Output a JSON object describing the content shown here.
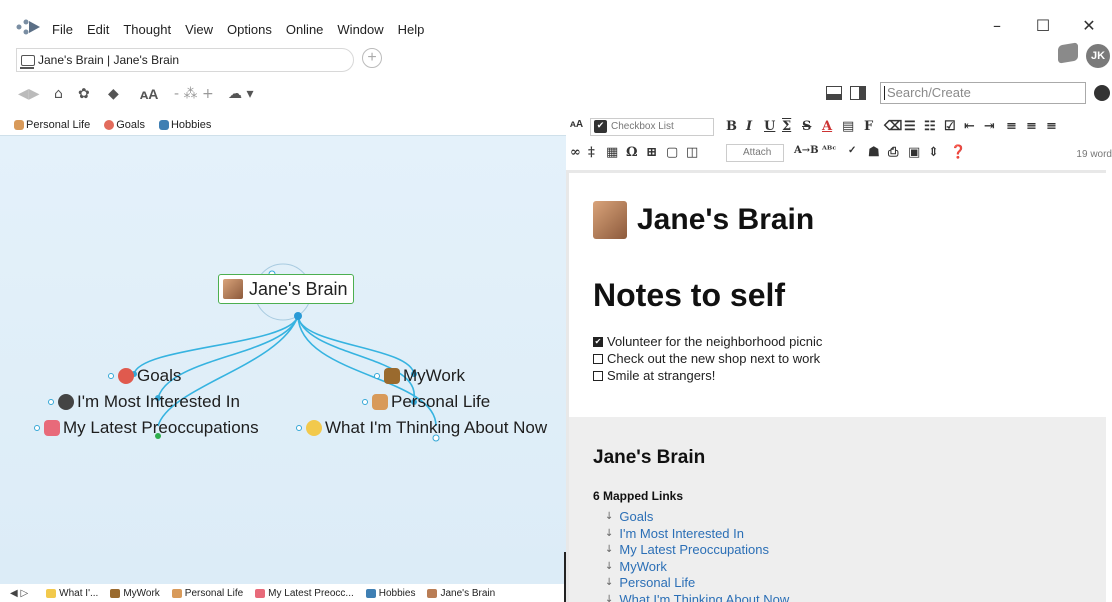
{
  "menu": {
    "items": [
      "File",
      "Edit",
      "Thought",
      "View",
      "Options",
      "Online",
      "Window",
      "Help"
    ]
  },
  "window_controls": {
    "minimize": "–",
    "maximize": "☐",
    "close": "✕"
  },
  "tab": {
    "title": "Jane's Brain | Jane's Brain",
    "new_tab_symbol": "+"
  },
  "account": {
    "initials": "JK"
  },
  "toolbar": {
    "search_placeholder": "Search/Create",
    "icons": [
      "back-forward-icon",
      "home-icon",
      "brain-icon",
      "tag-icon",
      "font-size-icon",
      "layout-icon",
      "cloud-icon"
    ]
  },
  "pins": [
    {
      "label": "Personal Life",
      "color": "#d89a5a"
    },
    {
      "label": "Goals",
      "color": "#e26b5c"
    },
    {
      "label": "Hobbies",
      "color": "#3f7fb3"
    }
  ],
  "plex": {
    "central": "Jane's Brain",
    "children_left": [
      {
        "label": "Goals",
        "color": "#e05a4e"
      },
      {
        "label": "I'm Most Interested In",
        "color": "#444444"
      },
      {
        "label": "My Latest Preoccupations",
        "color": "#e86a7a"
      }
    ],
    "children_right": [
      {
        "label": "MyWork",
        "color": "#9a6a2e"
      },
      {
        "label": "Personal Life",
        "color": "#d89a5a"
      },
      {
        "label": "What I'm Thinking About Now",
        "color": "#f2c94c"
      }
    ],
    "link_color": "#36b3e0",
    "selection_color": "#4caf50"
  },
  "history": [
    {
      "label": "What I'...",
      "color": "#f2c94c"
    },
    {
      "label": "MyWork",
      "color": "#9a6a2e"
    },
    {
      "label": "Personal Life",
      "color": "#d89a5a"
    },
    {
      "label": "My Latest Preocc...",
      "color": "#e86a7a"
    },
    {
      "label": "Hobbies",
      "color": "#3f7fb3"
    },
    {
      "label": "Jane's Brain",
      "color": "#b97d55"
    }
  ],
  "notes_toolbar": {
    "style_select": "Checkbox List",
    "attach_label": "Attach",
    "word_count": "19 word"
  },
  "notes": {
    "title": "Jane's Brain",
    "heading": "Notes to self",
    "checklist": [
      {
        "text": "Volunteer for the neighborhood picnic",
        "checked": true
      },
      {
        "text": "Check out the new shop next to work",
        "checked": false
      },
      {
        "text": "Smile at strangers!",
        "checked": false
      }
    ],
    "links_title": "Jane's Brain",
    "links_count": "6 Mapped Links",
    "links": [
      "Goals",
      "I'm Most Interested In",
      "My Latest Preoccupations",
      "MyWork",
      "Personal Life",
      "What I'm Thinking About Now"
    ]
  }
}
